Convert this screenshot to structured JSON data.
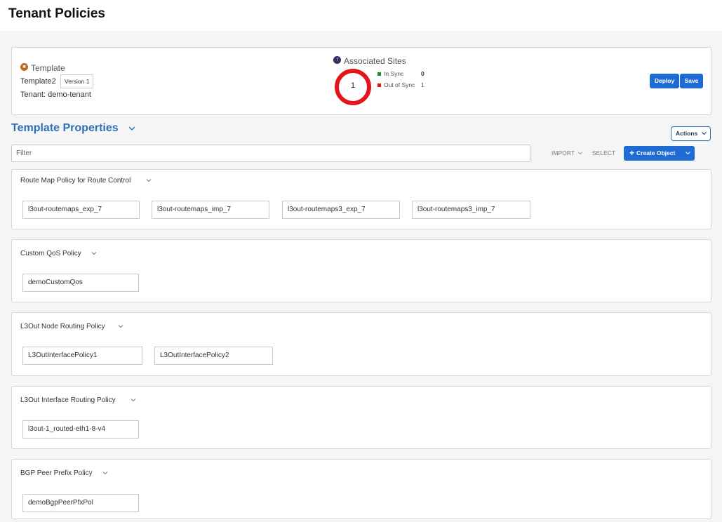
{
  "page": {
    "title": "Tenant Policies"
  },
  "header": {
    "template_label": "Template",
    "template_name": "Template2",
    "version_badge": "Version 1",
    "tenant_label": "Tenant: demo-tenant",
    "associated_sites_label": "Associated Sites",
    "sites_count": "1",
    "in_sync_label": "In Sync",
    "in_sync_value": "0",
    "out_of_sync_label": "Out of Sync",
    "out_of_sync_value": "1",
    "deploy_label": "Deploy",
    "save_label": "Save"
  },
  "properties": {
    "title": "Template Properties",
    "actions_label": "Actions",
    "filter_placeholder": "Filter",
    "import_label": "IMPORT",
    "select_label": "SELECT",
    "create_object_label": "Create Object"
  },
  "colors": {
    "accent": "#1f6bd4",
    "in_sync": "#1e8a2e",
    "out_of_sync": "#e3141b",
    "title_blue": "#2f6eb6"
  },
  "icons": {
    "template": "template-icon",
    "sites": "sites-icon",
    "chevron": "chevron-down-icon",
    "plus": "plus-icon"
  },
  "policies": [
    {
      "title": "Route Map Policy for Route Control",
      "items": [
        "l3out-routemaps_exp_7",
        "l3out-routemaps_imp_7",
        "l3out-routemaps3_exp_7",
        "l3out-routemaps3_imp_7"
      ]
    },
    {
      "title": "Custom QoS Policy",
      "items": [
        "demoCustomQos"
      ]
    },
    {
      "title": "L3Out Node Routing Policy",
      "items": [
        "L3OutInterfacePolicy1",
        "L3OutInterfacePolicy2"
      ]
    },
    {
      "title": "L3Out Interface Routing Policy",
      "items": [
        "l3out-1_routed-eth1-8-v4"
      ]
    },
    {
      "title": "BGP Peer Prefix Policy",
      "items": [
        "demoBgpPeerPfxPol"
      ]
    }
  ]
}
